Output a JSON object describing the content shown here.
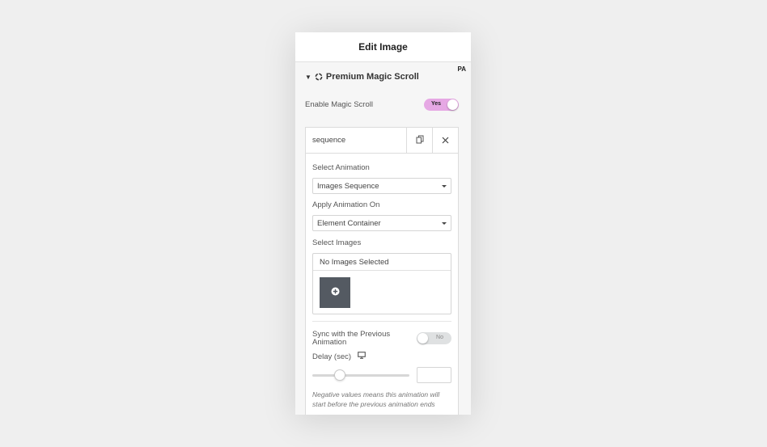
{
  "panel": {
    "title": "Edit Image",
    "badge": "PA"
  },
  "section": {
    "title": "Premium Magic Scroll",
    "caret_icon": "caret-down-icon",
    "icon": "premium-addons-icon"
  },
  "enable_magic_scroll": {
    "label": "Enable Magic Scroll",
    "toggle_text": "Yes",
    "value": true,
    "color": "#e6a8e4"
  },
  "repeater": {
    "item_title": "sequence",
    "duplicate_icon": "copy-icon",
    "remove_icon": "close-icon",
    "select_animation": {
      "label": "Select Animation",
      "value": "Images Sequence"
    },
    "apply_animation_on": {
      "label": "Apply Animation On",
      "value": "Element Container"
    },
    "select_images": {
      "label": "Select Images",
      "status": "No Images Selected",
      "add_icon": "plus-circle-icon"
    },
    "sync_previous": {
      "label": "Sync with the Previous Animation",
      "toggle_text": "No",
      "value": false
    },
    "delay": {
      "label": "Delay (sec)",
      "device_icon": "desktop-icon",
      "value": "",
      "note": "Negative values means this animation will start before the previous animation ends"
    }
  }
}
